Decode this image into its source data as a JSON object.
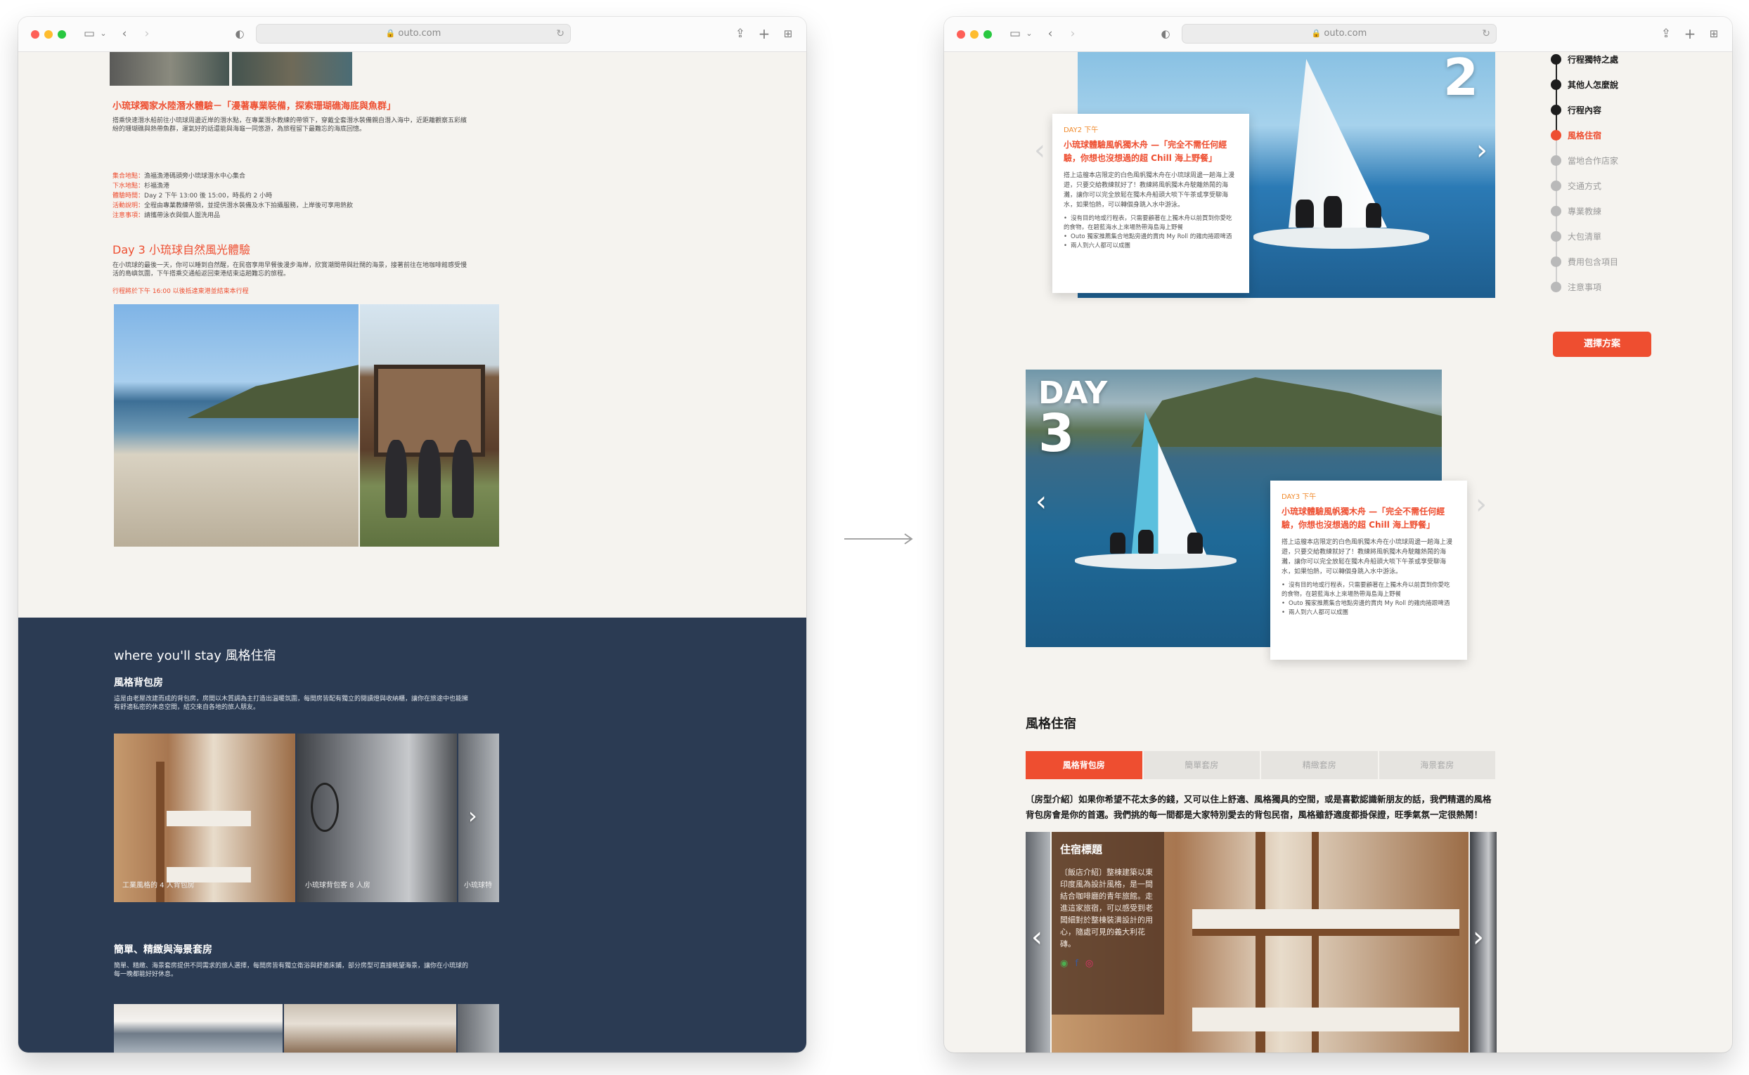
{
  "browser": {
    "url": "outo.com"
  },
  "left": {
    "section1": {
      "heading": "小琉球獨家水陸潛水體驗－「漫著專業裝備，探索珊瑚礁海底與魚群」",
      "body": "搭乘快速潛水船前往小琉球周邊近岸的潛水點，在專業潛水教練的帶領下，穿戴全套潛水裝備親自潛入海中，近距離觀察五彩繽紛的珊瑚礁與熱帶魚群，運氣好的話還能與海龜一同悠游，為旅程留下最難忘的海底回憶。",
      "meta_labels": [
        "集合地點：",
        "下水地點：",
        "體驗時間：",
        "活動說明：",
        "注意事項："
      ],
      "meta_values": [
        "漁福漁港碼頭旁小琉球潛水中心集合",
        "杉福漁港",
        "Day 2 下午 13:00 後 15:00，時長約 2 小時",
        "全程由專業教練帶領，並提供潛水裝備及水下拍攝服務，上岸後可享用熱飲",
        "請攜帶泳衣與個人盥洗用品"
      ]
    },
    "section2": {
      "heading": "Day 3 小琉球自然風光體驗",
      "body": "在小琉球的最後一天，你可以睡到自然醒，在民宿享用早餐後漫步海岸，欣賞潮間帶與壯闊的海景，接著前往在地咖啡館感受慢活的島嶼氛圍，下午搭乘交通船返回東港結束這趟難忘的旅程。",
      "note": "行程將於下午 16:00 以後抵達東港並結束本行程"
    },
    "stay": {
      "heading": "where you'll stay 風格住宿",
      "sub1": "風格背包房",
      "sub1_body": "這是由老屋改建而成的背包房，房間以木質調為主打造出溫暖氛圍，每間房皆配有獨立的閱讀燈與收納櫃，讓你在旅途中也能擁有舒適私密的休息空間，結交來自各地的旅人朋友。",
      "captions": [
        "工業風格的 4 人背包房",
        "小琉球背包客 8 人房",
        "小琉球特"
      ],
      "sub2": "簡單、精緻與海景套房",
      "sub2_body": "簡單、精緻、海景套房提供不同需求的旅人選擇，每間房皆有獨立衛浴與舒適床鋪，部分房型可直接眺望海景，讓你在小琉球的每一晚都能好好休息。"
    }
  },
  "right": {
    "toc": {
      "items": [
        "行程獨特之處",
        "其他人怎麼說",
        "行程內容",
        "風格住宿",
        "當地合作店家",
        "交通方式",
        "專業教練",
        "大包清單",
        "費用包含項目",
        "注意事項"
      ],
      "cta": "選擇方案"
    },
    "day2": {
      "number": "2",
      "card": {
        "tag": "DAY2 下午",
        "title": "小琉球體驗風帆獨木舟 —「完全不需任何經驗，你想也沒想過的超 Chill 海上野餐」",
        "desc": "搭上這艘本店限定的白色風帆獨木舟在小琉球周邊一趟海上漫遊，只要交給教練就好了！教練將風帆獨木舟駛離熱鬧的海灘，讓你可以完全放鬆在獨木舟船頭大啖下午茶或享受聊海水，如果怕熱，可以轉個身跳入水中游泳。",
        "bullets": [
          "沒有目的地或行程表，只需要顧著在上獨木舟以前買到你愛吃的食物，在碧藍海水上來場熱帶海島海上野餐",
          "Outo 獨家推薦集合地點旁邊的賣肉 My Roll 的雞肉捲跟啤酒",
          "兩人到六人都可以成團"
        ]
      }
    },
    "day3": {
      "label": "DAY",
      "number": "3",
      "card": {
        "tag": "DAY3 下午",
        "title": "小琉球體驗風帆獨木舟 —「完全不需任何經驗，你想也沒想過的超 Chill 海上野餐」",
        "desc": "搭上這艘本店限定的白色風帆獨木舟在小琉球周邊一趟海上漫遊，只要交給教練就好了！教練將風帆獨木舟駛離熱鬧的海灘，讓你可以完全放鬆在獨木舟船頭大啖下午茶或享受聊海水，如果怕熱，可以轉個身跳入水中游泳。",
        "bullets": [
          "沒有目的地或行程表，只需要顧著在上獨木舟以前買到你愛吃的食物，在碧藍海水上來場熱帶海島海上野餐",
          "Outo 獨家推薦集合地點旁邊的賣肉 My Roll 的雞肉捲跟啤酒",
          "兩人到六人都可以成團"
        ]
      }
    },
    "stay": {
      "heading": "風格住宿",
      "tabs": [
        "風格背包房",
        "簡單套房",
        "精緻套房",
        "海景套房"
      ],
      "intro": "〔房型介紹〕如果你希望不花太多的錢，又可以住上舒適、風格獨具的空間，或是喜歡認識新朋友的話，我們精選的風格背包房會是你的首選。我們挑的每一間都是大家特別愛去的背包民宿，風格雖舒適度都掛保證，旺季氣氛一定很熱鬧！",
      "overlay_title": "住宿標題",
      "overlay_body": "〔飯店介紹〕整棟建築以東印度風為設計風格，是一間結合咖啡廳的青年旅館。走進這家旅宿，可以感受到老闆細對於整棟裝潢設計的用心，隨處可見的義大利花磚。"
    }
  },
  "colors": {
    "accent": "#ee4e30",
    "navy": "#2b3b53",
    "page_bg": "#f5f3ef"
  }
}
